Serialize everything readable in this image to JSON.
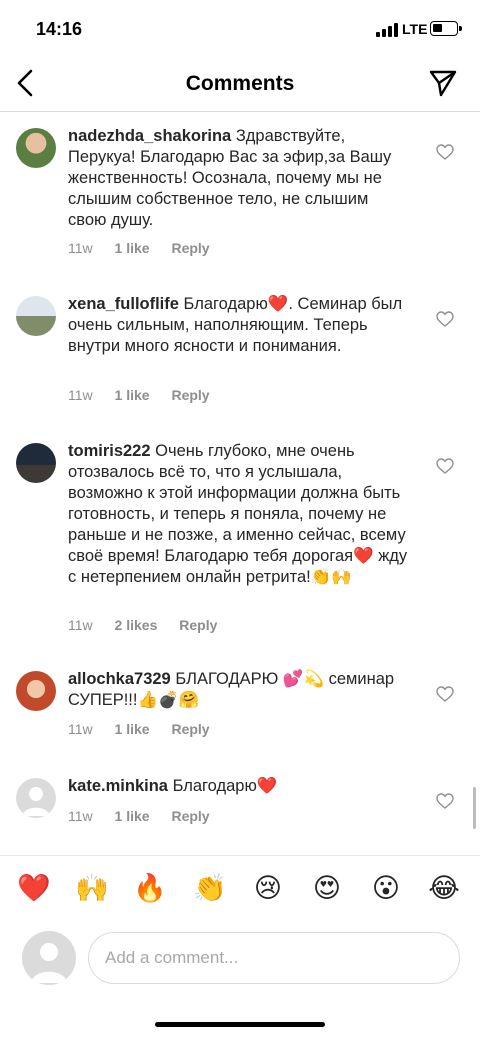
{
  "status_bar": {
    "time": "14:16",
    "network": "LTE",
    "icons": [
      "signal-icon",
      "battery-icon"
    ]
  },
  "header": {
    "title": "Comments",
    "icons": [
      "back-icon",
      "send-icon"
    ]
  },
  "comments": [
    {
      "username": "nadezhda_shakorina",
      "text": "Здравствуйте, Перукуа! Благодарю Вас за эфир,за Вашу женственность! Осознала, почему мы не слышим собственное тело, не слышим свою душу.",
      "time": "11w",
      "likes": "1 like",
      "reply": "Reply"
    },
    {
      "username": "xena_fulloflife",
      "text": "Благодарю❤️. Семинар был очень сильным, наполняющим. Теперь внутри много ясности и понимания.",
      "time": "11w",
      "likes": "1 like",
      "reply": "Reply"
    },
    {
      "username": "tomiris222",
      "text": "Очень глубоко, мне очень отозвалось всё то, что я услышала, возможно к этой информации должна быть готовность, и теперь я поняла, почему не раньше и не позже, а именно сейчас, всему своё время! Благодарю тебя дорогая❤️ жду с нетерпением онлайн ретрита!👏🙌",
      "time": "11w",
      "likes": "2 likes",
      "reply": "Reply"
    },
    {
      "username": "allochka7329",
      "text": "БЛАГОДАРЮ 💕💫 семинар СУПЕР!!!👍💣🤗",
      "time": "11w",
      "likes": "1 like",
      "reply": "Reply"
    },
    {
      "username": "kate.minkina",
      "text": "Благодарю❤️",
      "time": "11w",
      "likes": "1 like",
      "reply": "Reply"
    }
  ],
  "emoji_bar": [
    "❤️",
    "🙌",
    "🔥",
    "👏",
    "😢",
    "😍",
    "😮",
    "😂"
  ],
  "comment_input": {
    "placeholder": "Add a comment..."
  },
  "colors": {
    "text": "#262626",
    "meta": "#8e8e8e",
    "divider": "#dbdbdb"
  }
}
